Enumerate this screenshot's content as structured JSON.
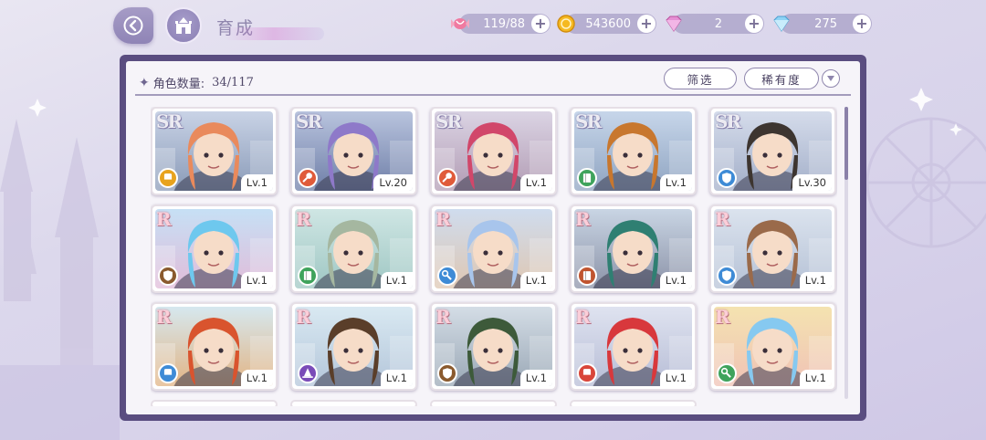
{
  "header": {
    "title": "育成",
    "back_icon": "back-arrow-icon",
    "home_icon": "castle-icon"
  },
  "resources": [
    {
      "name": "candy",
      "icon": "candy-icon",
      "value": "119/88",
      "color": "#e96c8c"
    },
    {
      "name": "coin",
      "icon": "coin-icon",
      "value": "543600",
      "color": "#f2b11e"
    },
    {
      "name": "pink-gem",
      "icon": "pink-diamond-icon",
      "value": "2",
      "color": "#e06fbf"
    },
    {
      "name": "blue-gem",
      "icon": "blue-diamond-icon",
      "value": "275",
      "color": "#7fc9f2"
    }
  ],
  "panel": {
    "count_label": "角色数量:",
    "count_value": "34/117",
    "filter_label": "筛选",
    "rarity_label": "稀有度"
  },
  "characters": [
    {
      "rarity": "SR",
      "level": "Lv.1",
      "class_icon": "fist-icon",
      "class_color": "#e8a31e",
      "hair": "#e98a5c",
      "scene": [
        "#c9d3e6",
        "#8a9bb8"
      ]
    },
    {
      "rarity": "SR",
      "level": "Lv.20",
      "class_icon": "wand-icon",
      "class_color": "#e05b3a",
      "hair": "#8e79c9",
      "scene": [
        "#b9c4de",
        "#6f7fa8"
      ]
    },
    {
      "rarity": "SR",
      "level": "Lv.1",
      "class_icon": "wand-icon",
      "class_color": "#e05b3a",
      "hair": "#d1476a",
      "scene": [
        "#dbd4e4",
        "#b29cb4"
      ]
    },
    {
      "rarity": "SR",
      "level": "Lv.1",
      "class_icon": "book-icon",
      "class_color": "#3fa35c",
      "hair": "#c8772e",
      "scene": [
        "#c7d6ea",
        "#8fa4c1"
      ]
    },
    {
      "rarity": "SR",
      "level": "Lv.30",
      "class_icon": "shield-icon",
      "class_color": "#3e8bd6",
      "hair": "#3d3530",
      "scene": [
        "#d5dceb",
        "#a3afc9"
      ]
    },
    {
      "rarity": "R",
      "level": "Lv.1",
      "class_icon": "shield-icon",
      "class_color": "#8a5a2e",
      "hair": "#6ec8ee",
      "scene": [
        "#c6e0f5",
        "#e1bcd9"
      ]
    },
    {
      "rarity": "R",
      "level": "Lv.1",
      "class_icon": "book-icon",
      "class_color": "#3fa35c",
      "hair": "#a5b7a0",
      "scene": [
        "#cfe6e4",
        "#9fc7c3"
      ]
    },
    {
      "rarity": "R",
      "level": "Lv.1",
      "class_icon": "key-icon",
      "class_color": "#3e8bd6",
      "hair": "#a8c5ec",
      "scene": [
        "#cfdcee",
        "#dfc7b2"
      ]
    },
    {
      "rarity": "R",
      "level": "Lv.1",
      "class_icon": "book-icon",
      "class_color": "#c0542f",
      "hair": "#2f7f72",
      "scene": [
        "#c9d5e4",
        "#8c93a8"
      ]
    },
    {
      "rarity": "R",
      "level": "Lv.1",
      "class_icon": "shield-icon",
      "class_color": "#3e8bd6",
      "hair": "#9a6a4a",
      "scene": [
        "#dbe3ee",
        "#b6c2d6"
      ]
    },
    {
      "rarity": "R",
      "level": "Lv.1",
      "class_icon": "fist-icon",
      "class_color": "#3e8bd6",
      "hair": "#d9542e",
      "scene": [
        "#d6e8ef",
        "#e2b484"
      ]
    },
    {
      "rarity": "R",
      "level": "Lv.1",
      "class_icon": "hat-icon",
      "class_color": "#7a4bb8",
      "hair": "#5a3e2a",
      "scene": [
        "#d9e9f2",
        "#b4c6da"
      ]
    },
    {
      "rarity": "R",
      "level": "Lv.1",
      "class_icon": "shield-icon",
      "class_color": "#8a5a2e",
      "hair": "#3d5a3a",
      "scene": [
        "#d4dde6",
        "#9aa8b6"
      ]
    },
    {
      "rarity": "R",
      "level": "Lv.1",
      "class_icon": "fist-icon",
      "class_color": "#d9463a",
      "hair": "#d8383c",
      "scene": [
        "#dfe3f0",
        "#b7bdd6"
      ]
    },
    {
      "rarity": "R",
      "level": "Lv.1",
      "class_icon": "key-icon",
      "class_color": "#3fa35c",
      "hair": "#86c9f0",
      "scene": [
        "#f4e3b0",
        "#f0c2b6"
      ]
    }
  ]
}
